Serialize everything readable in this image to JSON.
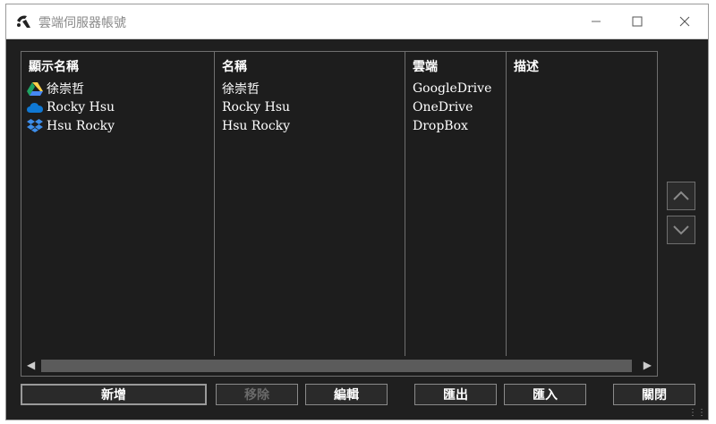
{
  "window": {
    "title": "雲端伺服器帳號"
  },
  "columns": [
    "顯示名稱",
    "名稱",
    "雲端",
    "描述"
  ],
  "rows": [
    {
      "icon": "google-drive-icon",
      "display_name": "徐崇哲",
      "name": "徐崇哲",
      "cloud": "GoogleDrive",
      "description": ""
    },
    {
      "icon": "onedrive-icon",
      "display_name": "Rocky Hsu",
      "name": "Rocky Hsu",
      "cloud": "OneDrive",
      "description": ""
    },
    {
      "icon": "dropbox-icon",
      "display_name": "Hsu Rocky",
      "name": "Hsu Rocky",
      "cloud": "DropBox",
      "description": ""
    }
  ],
  "buttons": {
    "add": "新增",
    "remove": "移除",
    "edit": "編輯",
    "export": "匯出",
    "import": "匯入",
    "close": "關閉"
  },
  "colors": {
    "background": "#1f1f1f",
    "text": "#ffffff",
    "border": "#6f6f6f",
    "google_drive_green": "#1fa463",
    "google_drive_yellow": "#ffd04b",
    "google_drive_blue": "#4688f4",
    "onedrive_blue": "#0f78d4",
    "dropbox_blue": "#3d8eea"
  }
}
